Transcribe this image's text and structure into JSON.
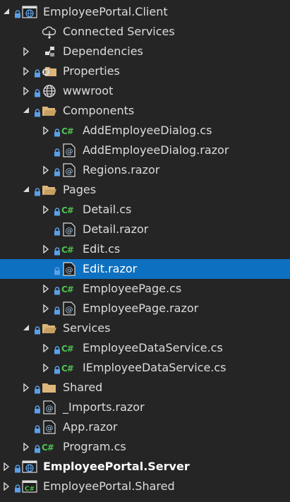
{
  "tree": [
    {
      "label": "EmployeePortal.Client",
      "level": 0,
      "arrow": "expanded",
      "lock": true,
      "icon": "web-project-icon"
    },
    {
      "label": "Connected Services",
      "level": 1,
      "arrow": "none",
      "lock": false,
      "icon": "connected-services-icon"
    },
    {
      "label": "Dependencies",
      "level": 1,
      "arrow": "collapsed",
      "lock": false,
      "icon": "dependencies-icon"
    },
    {
      "label": "Properties",
      "level": 1,
      "arrow": "collapsed",
      "lock": true,
      "icon": "properties-folder-icon"
    },
    {
      "label": "wwwroot",
      "level": 1,
      "arrow": "collapsed",
      "lock": true,
      "icon": "globe-icon"
    },
    {
      "label": "Components",
      "level": 1,
      "arrow": "expanded",
      "lock": true,
      "icon": "folder-open-icon"
    },
    {
      "label": "AddEmployeeDialog.cs",
      "level": 2,
      "arrow": "collapsed",
      "lock": true,
      "icon": "csharp-file-icon"
    },
    {
      "label": "AddEmployeeDialog.razor",
      "level": 2,
      "arrow": "none",
      "lock": true,
      "icon": "razor-file-icon"
    },
    {
      "label": "Regions.razor",
      "level": 2,
      "arrow": "collapsed",
      "lock": true,
      "icon": "razor-file-icon"
    },
    {
      "label": "Pages",
      "level": 1,
      "arrow": "expanded",
      "lock": true,
      "icon": "folder-open-icon"
    },
    {
      "label": "Detail.cs",
      "level": 2,
      "arrow": "collapsed",
      "lock": true,
      "icon": "csharp-file-icon"
    },
    {
      "label": "Detail.razor",
      "level": 2,
      "arrow": "none",
      "lock": true,
      "icon": "razor-file-icon"
    },
    {
      "label": "Edit.cs",
      "level": 2,
      "arrow": "collapsed",
      "lock": true,
      "icon": "csharp-file-icon"
    },
    {
      "label": "Edit.razor",
      "level": 2,
      "arrow": "none",
      "lock": true,
      "icon": "razor-file-icon",
      "selected": true
    },
    {
      "label": "EmployeePage.cs",
      "level": 2,
      "arrow": "collapsed",
      "lock": true,
      "icon": "csharp-file-icon"
    },
    {
      "label": "EmployeePage.razor",
      "level": 2,
      "arrow": "collapsed",
      "lock": true,
      "icon": "razor-file-icon"
    },
    {
      "label": "Services",
      "level": 1,
      "arrow": "expanded",
      "lock": true,
      "icon": "folder-open-icon"
    },
    {
      "label": "EmployeeDataService.cs",
      "level": 2,
      "arrow": "collapsed",
      "lock": true,
      "icon": "csharp-file-icon"
    },
    {
      "label": "IEmployeeDataService.cs",
      "level": 2,
      "arrow": "collapsed",
      "lock": true,
      "icon": "csharp-file-icon"
    },
    {
      "label": "Shared",
      "level": 1,
      "arrow": "collapsed",
      "lock": true,
      "icon": "folder-closed-icon"
    },
    {
      "label": "_Imports.razor",
      "level": 1,
      "arrow": "none",
      "lock": true,
      "icon": "razor-file-icon"
    },
    {
      "label": "App.razor",
      "level": 1,
      "arrow": "none",
      "lock": true,
      "icon": "razor-file-icon"
    },
    {
      "label": "Program.cs",
      "level": 1,
      "arrow": "collapsed",
      "lock": true,
      "icon": "csharp-file-icon"
    },
    {
      "label": "EmployeePortal.Server",
      "level": 0,
      "arrow": "collapsed",
      "lock": true,
      "icon": "web-project-icon",
      "bold": true
    },
    {
      "label": "EmployeePortal.Shared",
      "level": 0,
      "arrow": "collapsed",
      "lock": true,
      "icon": "csharp-project-icon"
    }
  ],
  "colors": {
    "background": "#252526",
    "selection": "#0e70c0",
    "text": "#dcdcdc",
    "folder": "#dcb67a",
    "csharp": "#4fc14f",
    "razor": "#a9c9e6",
    "lock": "#5aa0e8"
  }
}
